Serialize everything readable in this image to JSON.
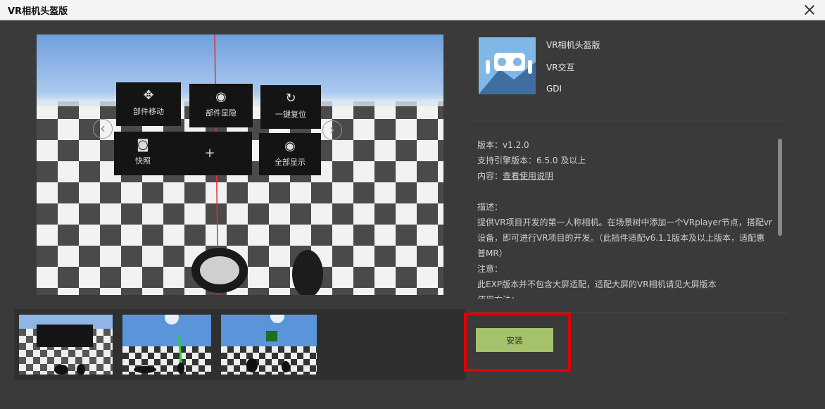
{
  "window": {
    "title": "VR相机头盔版"
  },
  "preview": {
    "buttons": [
      {
        "label": "部件移动",
        "icon": "move-icon"
      },
      {
        "label": "部件显隐",
        "icon": "eye-icon"
      },
      {
        "label": "一键复位",
        "icon": "reset-icon"
      },
      {
        "label": "快照",
        "icon": "camera-icon"
      },
      {
        "label": "+",
        "icon": "plus-icon"
      },
      {
        "label": "全部显示",
        "icon": "eye-icon"
      }
    ],
    "prev_arrow": "‹",
    "next_arrow": "›"
  },
  "app": {
    "name": "VR相机头盔版",
    "category": "VR交互",
    "vendor": "GDI"
  },
  "details": {
    "version_label": "版本：",
    "version": "v1.2.0",
    "engine_label": "支持引擎版本：",
    "engine": "6.5.0 及以上",
    "content_label": "内容：",
    "content_link": "查看使用说明",
    "desc_label": "描述：",
    "desc": "提供VR项目开发的第一人称相机。在场景树中添加一个VRplayer节点，搭配vr设备，即可进行VR项目的开发。（此插件适配v6.1.1版本及以上版本，适配惠普MR）",
    "note_label": "注意：",
    "note": "此EXP版本并不包含大屏适配，适配大屏的VR相机请见大屏版本",
    "usage_label": "使用方法："
  },
  "install_label": "安装",
  "colors": {
    "install_bg": "#a4c26a",
    "highlight": "#e00000",
    "sky": "#a9c8ee"
  }
}
